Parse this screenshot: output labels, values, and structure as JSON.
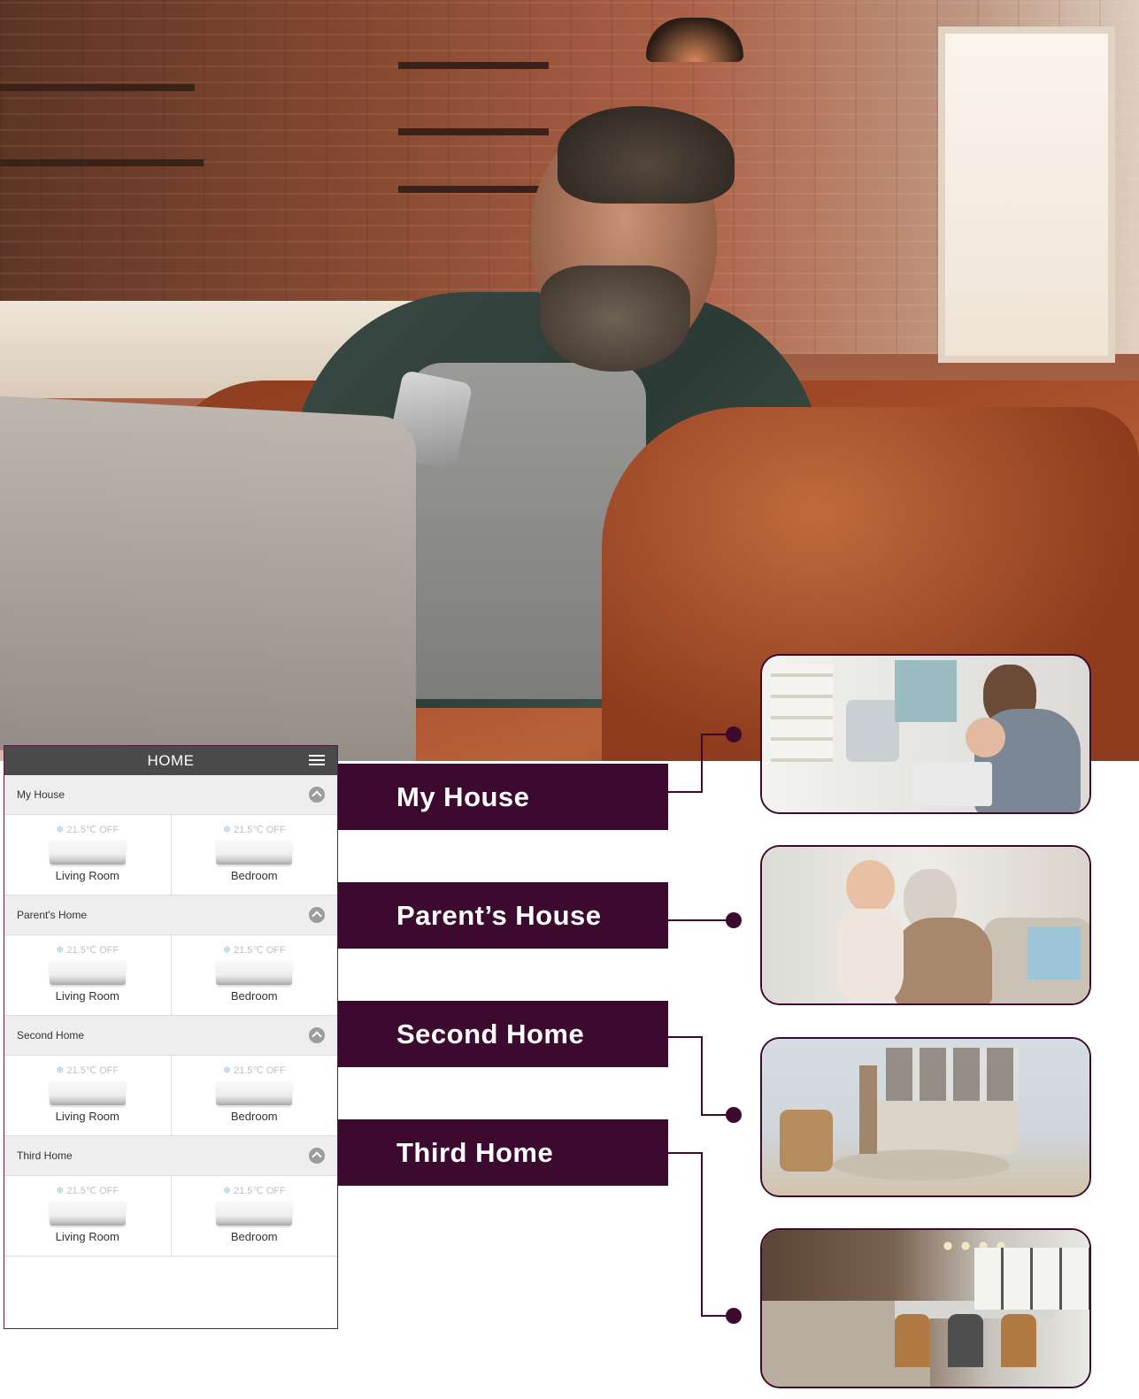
{
  "app": {
    "title": "HOME",
    "menu_icon": "hamburger-menu-icon"
  },
  "homes": [
    {
      "name": "My House",
      "units": [
        {
          "temp": "21.5℃",
          "state": "OFF",
          "room": "Living Room"
        },
        {
          "temp": "21.5℃",
          "state": "OFF",
          "room": "Bedroom"
        }
      ]
    },
    {
      "name": "Parent's Home",
      "units": [
        {
          "temp": "21.5℃",
          "state": "OFF",
          "room": "Living Room"
        },
        {
          "temp": "21.5℃",
          "state": "OFF",
          "room": "Bedroom"
        }
      ]
    },
    {
      "name": "Second Home",
      "units": [
        {
          "temp": "21.5℃",
          "state": "OFF",
          "room": "Living Room"
        },
        {
          "temp": "21.5℃",
          "state": "OFF",
          "room": "Bedroom"
        }
      ]
    },
    {
      "name": "Third Home",
      "units": [
        {
          "temp": "21.5℃",
          "state": "OFF",
          "room": "Living Room"
        },
        {
          "temp": "21.5℃",
          "state": "OFF",
          "room": "Bedroom"
        }
      ]
    }
  ],
  "labels": [
    "My House",
    "Parent’s House",
    "Second Home",
    "Third Home"
  ],
  "colors": {
    "brand": "#3d0a2f",
    "topbar": "#4a4a4a",
    "section_bg": "#eeeeee"
  }
}
